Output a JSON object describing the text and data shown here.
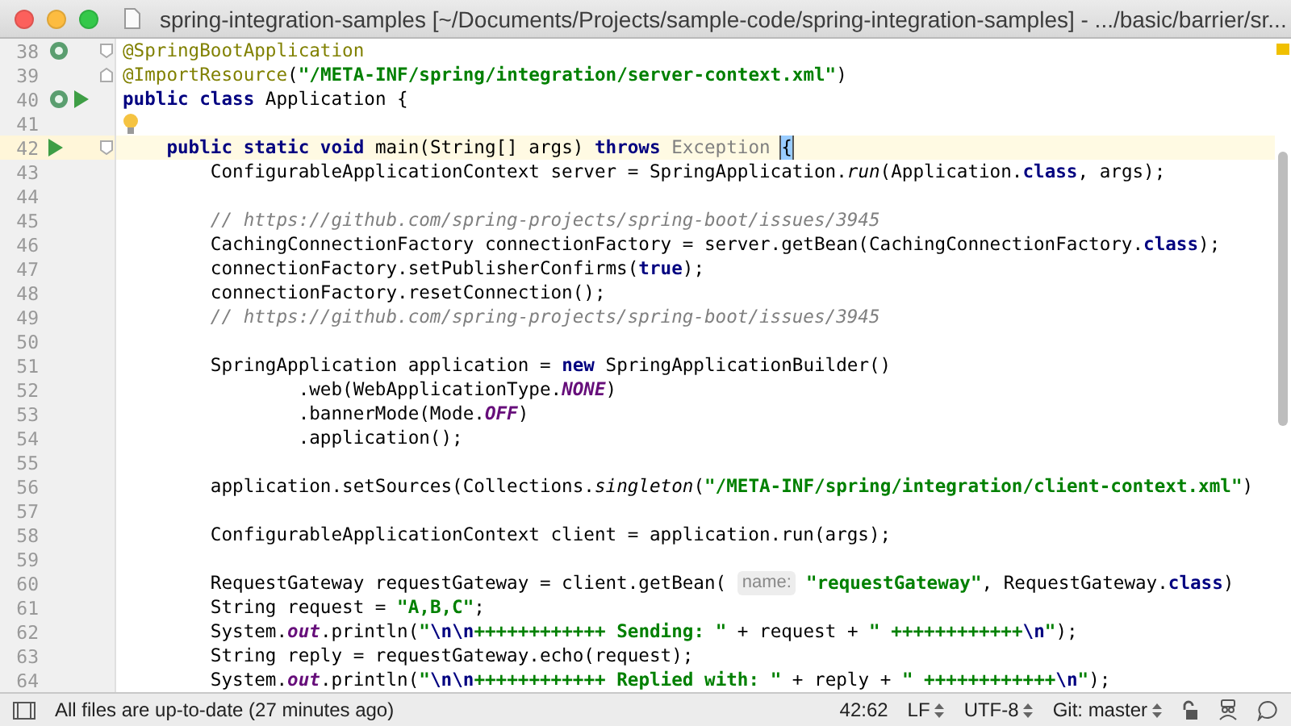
{
  "window": {
    "title": "spring-integration-samples [~/Documents/Projects/sample-code/spring-integration-samples] - .../basic/barrier/sr..."
  },
  "editor": {
    "lines": [
      {
        "number": "38",
        "current": false,
        "markers": [
          {
            "kind": "bean"
          },
          {
            "kind": "fold-start"
          }
        ],
        "tokens": [
          {
            "kind": "annotation",
            "text": "@SpringBootApplication"
          }
        ]
      },
      {
        "number": "39",
        "current": false,
        "markers": [
          {
            "kind": "fold-end"
          }
        ],
        "tokens": [
          {
            "kind": "annotation",
            "text": "@ImportResource"
          },
          {
            "kind": "plain",
            "text": "("
          },
          {
            "kind": "string",
            "text": "\"/META-INF/spring/integration/server-context.xml\""
          },
          {
            "kind": "plain",
            "text": ")"
          }
        ]
      },
      {
        "number": "40",
        "current": false,
        "markers": [
          {
            "kind": "bean"
          },
          {
            "kind": "run"
          }
        ],
        "tokens": [
          {
            "kind": "keyword",
            "text": "public class"
          },
          {
            "kind": "plain",
            "text": " Application {"
          }
        ]
      },
      {
        "number": "41",
        "current": false,
        "tokens": [
          {
            "kind": "bulb"
          }
        ]
      },
      {
        "number": "42",
        "current": true,
        "markers": [
          {
            "kind": "run"
          },
          {
            "kind": "fold-start"
          }
        ],
        "tokens": [
          {
            "kind": "keyword",
            "text": "    public static void"
          },
          {
            "kind": "plain",
            "text": " main(String[] args) "
          },
          {
            "kind": "keyword",
            "text": "throws"
          },
          {
            "kind": "muted",
            "text": " Exception "
          },
          {
            "kind": "brace",
            "text": "{"
          }
        ]
      },
      {
        "number": "43",
        "current": false,
        "tokens": [
          {
            "kind": "plain",
            "text": "        ConfigurableApplicationContext server = SpringApplication."
          },
          {
            "kind": "static",
            "text": "run"
          },
          {
            "kind": "plain",
            "text": "(Application."
          },
          {
            "kind": "keyword",
            "text": "class"
          },
          {
            "kind": "plain",
            "text": ", args);"
          }
        ]
      },
      {
        "number": "44",
        "current": false
      },
      {
        "number": "45",
        "current": false,
        "tokens": [
          {
            "kind": "comment",
            "text": "        // https://github.com/spring-projects/spring-boot/issues/3945"
          }
        ]
      },
      {
        "number": "46",
        "current": false,
        "tokens": [
          {
            "kind": "plain",
            "text": "        CachingConnectionFactory connectionFactory = server.getBean(CachingConnectionFactory."
          },
          {
            "kind": "keyword",
            "text": "class"
          },
          {
            "kind": "plain",
            "text": ");"
          }
        ]
      },
      {
        "number": "47",
        "current": false,
        "tokens": [
          {
            "kind": "plain",
            "text": "        connectionFactory.setPublisherConfirms("
          },
          {
            "kind": "keyword",
            "text": "true"
          },
          {
            "kind": "plain",
            "text": ");"
          }
        ]
      },
      {
        "number": "48",
        "current": false,
        "tokens": [
          {
            "kind": "plain",
            "text": "        connectionFactory.resetConnection();"
          }
        ]
      },
      {
        "number": "49",
        "current": false,
        "tokens": [
          {
            "kind": "comment",
            "text": "        // https://github.com/spring-projects/spring-boot/issues/3945"
          }
        ]
      },
      {
        "number": "50",
        "current": false
      },
      {
        "number": "51",
        "current": false,
        "tokens": [
          {
            "kind": "plain",
            "text": "        SpringApplication application = "
          },
          {
            "kind": "keyword",
            "text": "new"
          },
          {
            "kind": "plain",
            "text": " SpringApplicationBuilder()"
          }
        ]
      },
      {
        "number": "52",
        "current": false,
        "tokens": [
          {
            "kind": "plain",
            "text": "                .web(WebApplicationType."
          },
          {
            "kind": "constant",
            "text": "NONE"
          },
          {
            "kind": "plain",
            "text": ")"
          }
        ]
      },
      {
        "number": "53",
        "current": false,
        "tokens": [
          {
            "kind": "plain",
            "text": "                .bannerMode(Mode."
          },
          {
            "kind": "constant",
            "text": "OFF"
          },
          {
            "kind": "plain",
            "text": ")"
          }
        ]
      },
      {
        "number": "54",
        "current": false,
        "tokens": [
          {
            "kind": "plain",
            "text": "                .application();"
          }
        ]
      },
      {
        "number": "55",
        "current": false
      },
      {
        "number": "56",
        "current": false,
        "tokens": [
          {
            "kind": "plain",
            "text": "        application.setSources(Collections."
          },
          {
            "kind": "static",
            "text": "singleton"
          },
          {
            "kind": "plain",
            "text": "("
          },
          {
            "kind": "string",
            "text": "\"/META-INF/spring/integration/client-context.xml\""
          },
          {
            "kind": "plain",
            "text": ")"
          }
        ]
      },
      {
        "number": "57",
        "current": false
      },
      {
        "number": "58",
        "current": false,
        "tokens": [
          {
            "kind": "plain",
            "text": "        ConfigurableApplicationContext client = application.run(args);"
          }
        ]
      },
      {
        "number": "59",
        "current": false
      },
      {
        "number": "60",
        "current": false,
        "tokens": [
          {
            "kind": "plain",
            "text": "        RequestGateway requestGateway = client.getBean( "
          },
          {
            "kind": "hint",
            "text": "name:"
          },
          {
            "kind": "string",
            "text": "\"requestGateway\""
          },
          {
            "kind": "plain",
            "text": ", RequestGateway."
          },
          {
            "kind": "keyword",
            "text": "class"
          },
          {
            "kind": "plain",
            "text": ")"
          }
        ]
      },
      {
        "number": "61",
        "current": false,
        "tokens": [
          {
            "kind": "plain",
            "text": "        String request = "
          },
          {
            "kind": "string",
            "text": "\"A,B,C\""
          },
          {
            "kind": "plain",
            "text": ";"
          }
        ]
      },
      {
        "number": "62",
        "current": false,
        "tokens": [
          {
            "kind": "plain",
            "text": "        System."
          },
          {
            "kind": "constant",
            "text": "out"
          },
          {
            "kind": "plain",
            "text": ".println("
          },
          {
            "kind": "string",
            "text": "\""
          },
          {
            "kind": "escape",
            "text": "\\n\\n"
          },
          {
            "kind": "string",
            "text": "++++++++++++ Sending: \""
          },
          {
            "kind": "plain",
            "text": " + request + "
          },
          {
            "kind": "string",
            "text": "\" ++++++++++++"
          },
          {
            "kind": "escape",
            "text": "\\n"
          },
          {
            "kind": "string",
            "text": "\""
          },
          {
            "kind": "plain",
            "text": ");"
          }
        ]
      },
      {
        "number": "63",
        "current": false,
        "tokens": [
          {
            "kind": "plain",
            "text": "        String reply = requestGateway.echo(request);"
          }
        ]
      },
      {
        "number": "64",
        "current": false,
        "tokens": [
          {
            "kind": "plain",
            "text": "        System."
          },
          {
            "kind": "constant",
            "text": "out"
          },
          {
            "kind": "plain",
            "text": ".println("
          },
          {
            "kind": "string",
            "text": "\""
          },
          {
            "kind": "escape",
            "text": "\\n\\n"
          },
          {
            "kind": "string",
            "text": "++++++++++++ Replied with: \""
          },
          {
            "kind": "plain",
            "text": " + reply + "
          },
          {
            "kind": "string",
            "text": "\" ++++++++++++"
          },
          {
            "kind": "escape",
            "text": "\\n"
          },
          {
            "kind": "string",
            "text": "\""
          },
          {
            "kind": "plain",
            "text": ");"
          }
        ]
      }
    ]
  },
  "status_bar": {
    "message": "All files are up-to-date (27 minutes ago)",
    "position": "42:62",
    "line_separator": "LF",
    "encoding": "UTF-8",
    "vcs": "Git: master"
  }
}
